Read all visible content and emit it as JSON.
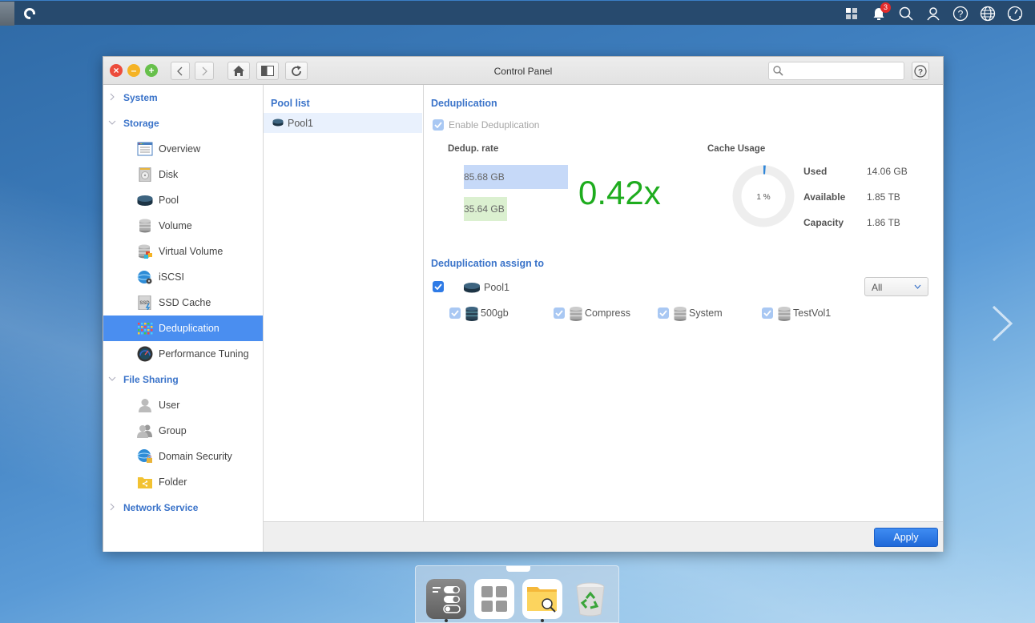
{
  "topbar": {
    "logo": "qnap-logo-icon",
    "icons": [
      {
        "name": "apps-grid-icon"
      },
      {
        "name": "notification-bell-icon",
        "badge": "3"
      },
      {
        "name": "search-icon"
      },
      {
        "name": "user-icon"
      },
      {
        "name": "help-icon"
      },
      {
        "name": "language-globe-icon"
      },
      {
        "name": "dashboard-gauge-icon"
      }
    ]
  },
  "window": {
    "title": "Control Panel",
    "search_placeholder": "",
    "toolbar": [
      "back",
      "forward",
      "home",
      "layout",
      "refresh"
    ]
  },
  "sidebar": {
    "sections": [
      {
        "label": "System",
        "expanded": false,
        "items": []
      },
      {
        "label": "Storage",
        "expanded": true,
        "items": [
          {
            "label": "Overview",
            "icon": "overview-icon"
          },
          {
            "label": "Disk",
            "icon": "disk-icon"
          },
          {
            "label": "Pool",
            "icon": "pool-icon"
          },
          {
            "label": "Volume",
            "icon": "volume-icon"
          },
          {
            "label": "Virtual Volume",
            "icon": "virtual-volume-icon"
          },
          {
            "label": "iSCSI",
            "icon": "iscsi-icon"
          },
          {
            "label": "SSD Cache",
            "icon": "ssd-cache-icon"
          },
          {
            "label": "Deduplication",
            "icon": "deduplication-icon",
            "active": true
          },
          {
            "label": "Performance Tuning",
            "icon": "performance-tuning-icon"
          }
        ]
      },
      {
        "label": "File Sharing",
        "expanded": true,
        "items": [
          {
            "label": "User",
            "icon": "user-icon"
          },
          {
            "label": "Group",
            "icon": "group-icon"
          },
          {
            "label": "Domain Security",
            "icon": "domain-security-icon"
          },
          {
            "label": "Folder",
            "icon": "folder-icon"
          }
        ]
      },
      {
        "label": "Network Service",
        "expanded": false,
        "items": []
      }
    ]
  },
  "pool_list": {
    "title": "Pool list",
    "items": [
      {
        "label": "Pool1",
        "selected": true
      }
    ]
  },
  "dedup": {
    "title": "Deduplication",
    "enable_label": "Enable Deduplication",
    "enabled": true,
    "rate_label": "Dedup. rate",
    "original_size": "85.68 GB",
    "deduped_size": "35.64 GB",
    "ratio": "0.42x",
    "cache": {
      "label": "Cache Usage",
      "percent_text": "1 %",
      "percent": 1,
      "used_label": "Used",
      "used": "14.06 GB",
      "available_label": "Available",
      "available": "1.85 TB",
      "capacity_label": "Capacity",
      "capacity": "1.86 TB"
    },
    "assign": {
      "title": "Deduplication assign to",
      "pool": {
        "label": "Pool1",
        "checked": true
      },
      "filter": "All",
      "volumes": [
        {
          "label": "500gb",
          "checked": true
        },
        {
          "label": "Compress",
          "checked": true
        },
        {
          "label": "System",
          "checked": true
        },
        {
          "label": "TestVol1",
          "checked": true
        }
      ]
    }
  },
  "footer": {
    "apply_label": "Apply"
  },
  "dock": {
    "apps": [
      {
        "name": "control-panel-app",
        "running": true
      },
      {
        "name": "app-center-app",
        "running": false
      },
      {
        "name": "file-station-app",
        "running": true
      },
      {
        "name": "recycle-bin-app",
        "running": false
      }
    ]
  }
}
